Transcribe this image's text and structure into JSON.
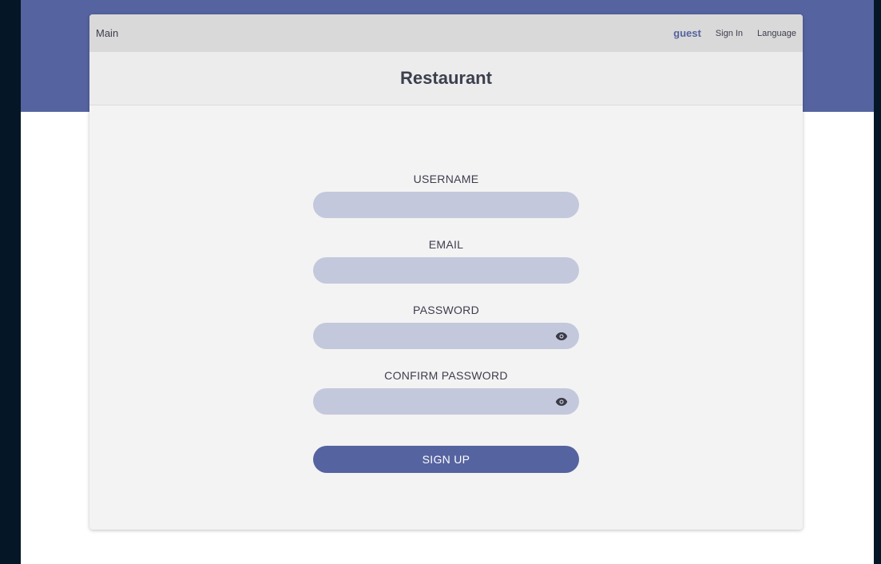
{
  "nav": {
    "main_label": "Main",
    "user": "guest",
    "sign_in": "Sign In",
    "language": "Language"
  },
  "header": {
    "title": "Restaurant"
  },
  "form": {
    "username_label": "USERNAME",
    "username_value": "",
    "email_label": "EMAIL",
    "email_value": "",
    "password_label": "PASSWORD",
    "password_value": "",
    "password_toggle_icon": "eye-icon",
    "confirm_label": "CONFIRM PASSWORD",
    "confirm_value": "",
    "confirm_toggle_icon": "eye-icon",
    "submit_label": "SIGN UP"
  },
  "colors": {
    "accent": "#5563a0",
    "input_bg": "#c4c8dc",
    "card_bg": "#f3f3f3",
    "nav_bg": "#d9d9d9",
    "header_bg": "#ececec",
    "page_edge": "#051726"
  }
}
